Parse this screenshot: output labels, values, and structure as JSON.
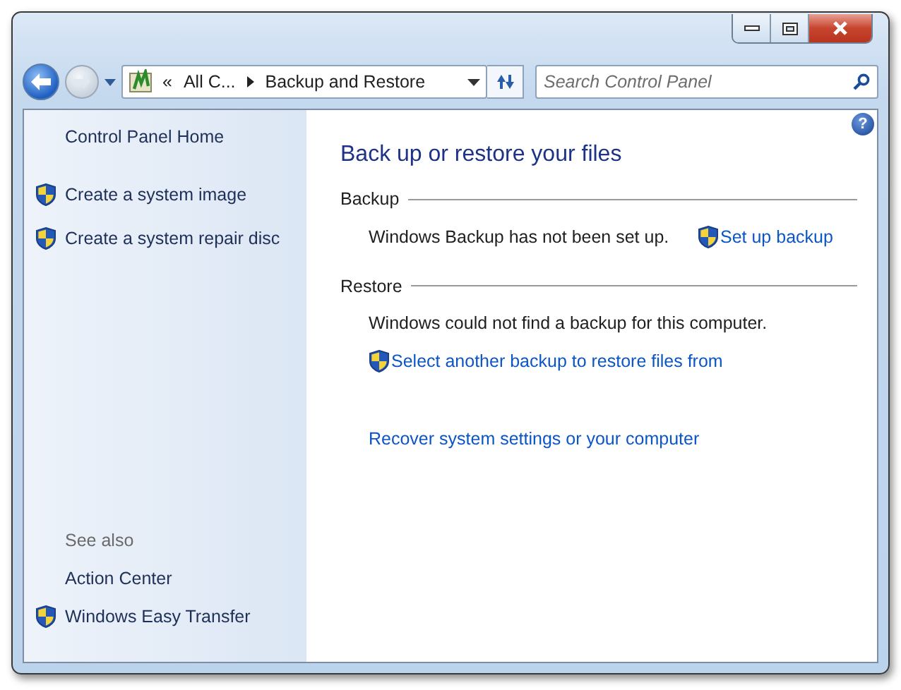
{
  "address_bar": {
    "overflow": "«",
    "crumbs": [
      "All C...",
      "Backup and Restore"
    ]
  },
  "search": {
    "placeholder": "Search Control Panel"
  },
  "help": "?",
  "sidebar": {
    "home": "Control Panel Home",
    "tasks": [
      {
        "label": "Create a system image",
        "shield": true
      },
      {
        "label": "Create a system repair disc",
        "shield": true
      }
    ],
    "see_also": {
      "heading": "See also",
      "links": [
        {
          "label": "Action Center",
          "shield": false
        },
        {
          "label": "Windows Easy Transfer",
          "shield": true
        }
      ]
    }
  },
  "main": {
    "title": "Back up or restore your files",
    "sections": [
      {
        "heading": "Backup",
        "kind": "status_with_action",
        "message": "Windows Backup has not been set up.",
        "actions": [
          {
            "label": "Set up backup",
            "shield": true
          }
        ]
      },
      {
        "heading": "Restore",
        "kind": "status",
        "message": "Windows could not find a backup for this computer.",
        "actions": [
          {
            "label": "Select another backup to restore files from",
            "shield": true
          }
        ]
      }
    ],
    "bottom_link": {
      "label": "Recover system settings or your computer",
      "shield": false
    }
  }
}
